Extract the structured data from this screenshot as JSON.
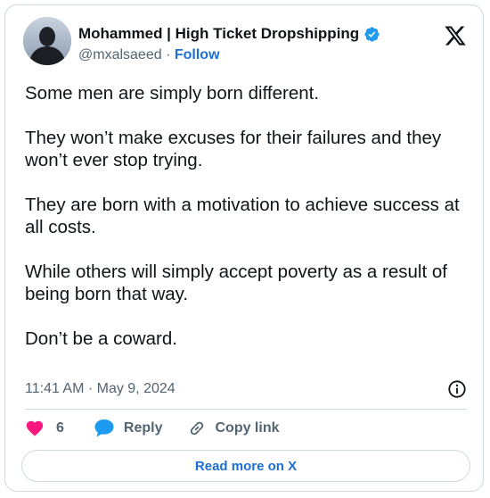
{
  "author": {
    "name": "Mohammed | High Ticket Dropshipping",
    "handle": "@mxalsaeed",
    "separator": "·",
    "follow_label": "Follow",
    "verified_color": "#1d9bf0"
  },
  "tweet": {
    "paragraphs": [
      "Some men are simply born different.",
      "They won’t make excuses for their failures and they won’t ever stop trying.",
      "They are born with a motivation to achieve success at all costs.",
      "While others will simply accept poverty as a result of being born that way.",
      "Don’t be a coward."
    ],
    "timestamp": "11:41 AM · May 9, 2024"
  },
  "actions": {
    "like_count": "6",
    "reply_label": "Reply",
    "copy_link_label": "Copy link",
    "like_color": "#f91880",
    "reply_color": "#1d9bf0"
  },
  "footer": {
    "read_more_label": "Read more on X"
  },
  "icons": [
    "avatar",
    "verified-badge-icon",
    "x-logo-icon",
    "info-icon",
    "heart-icon",
    "reply-bubble-icon",
    "link-icon"
  ]
}
